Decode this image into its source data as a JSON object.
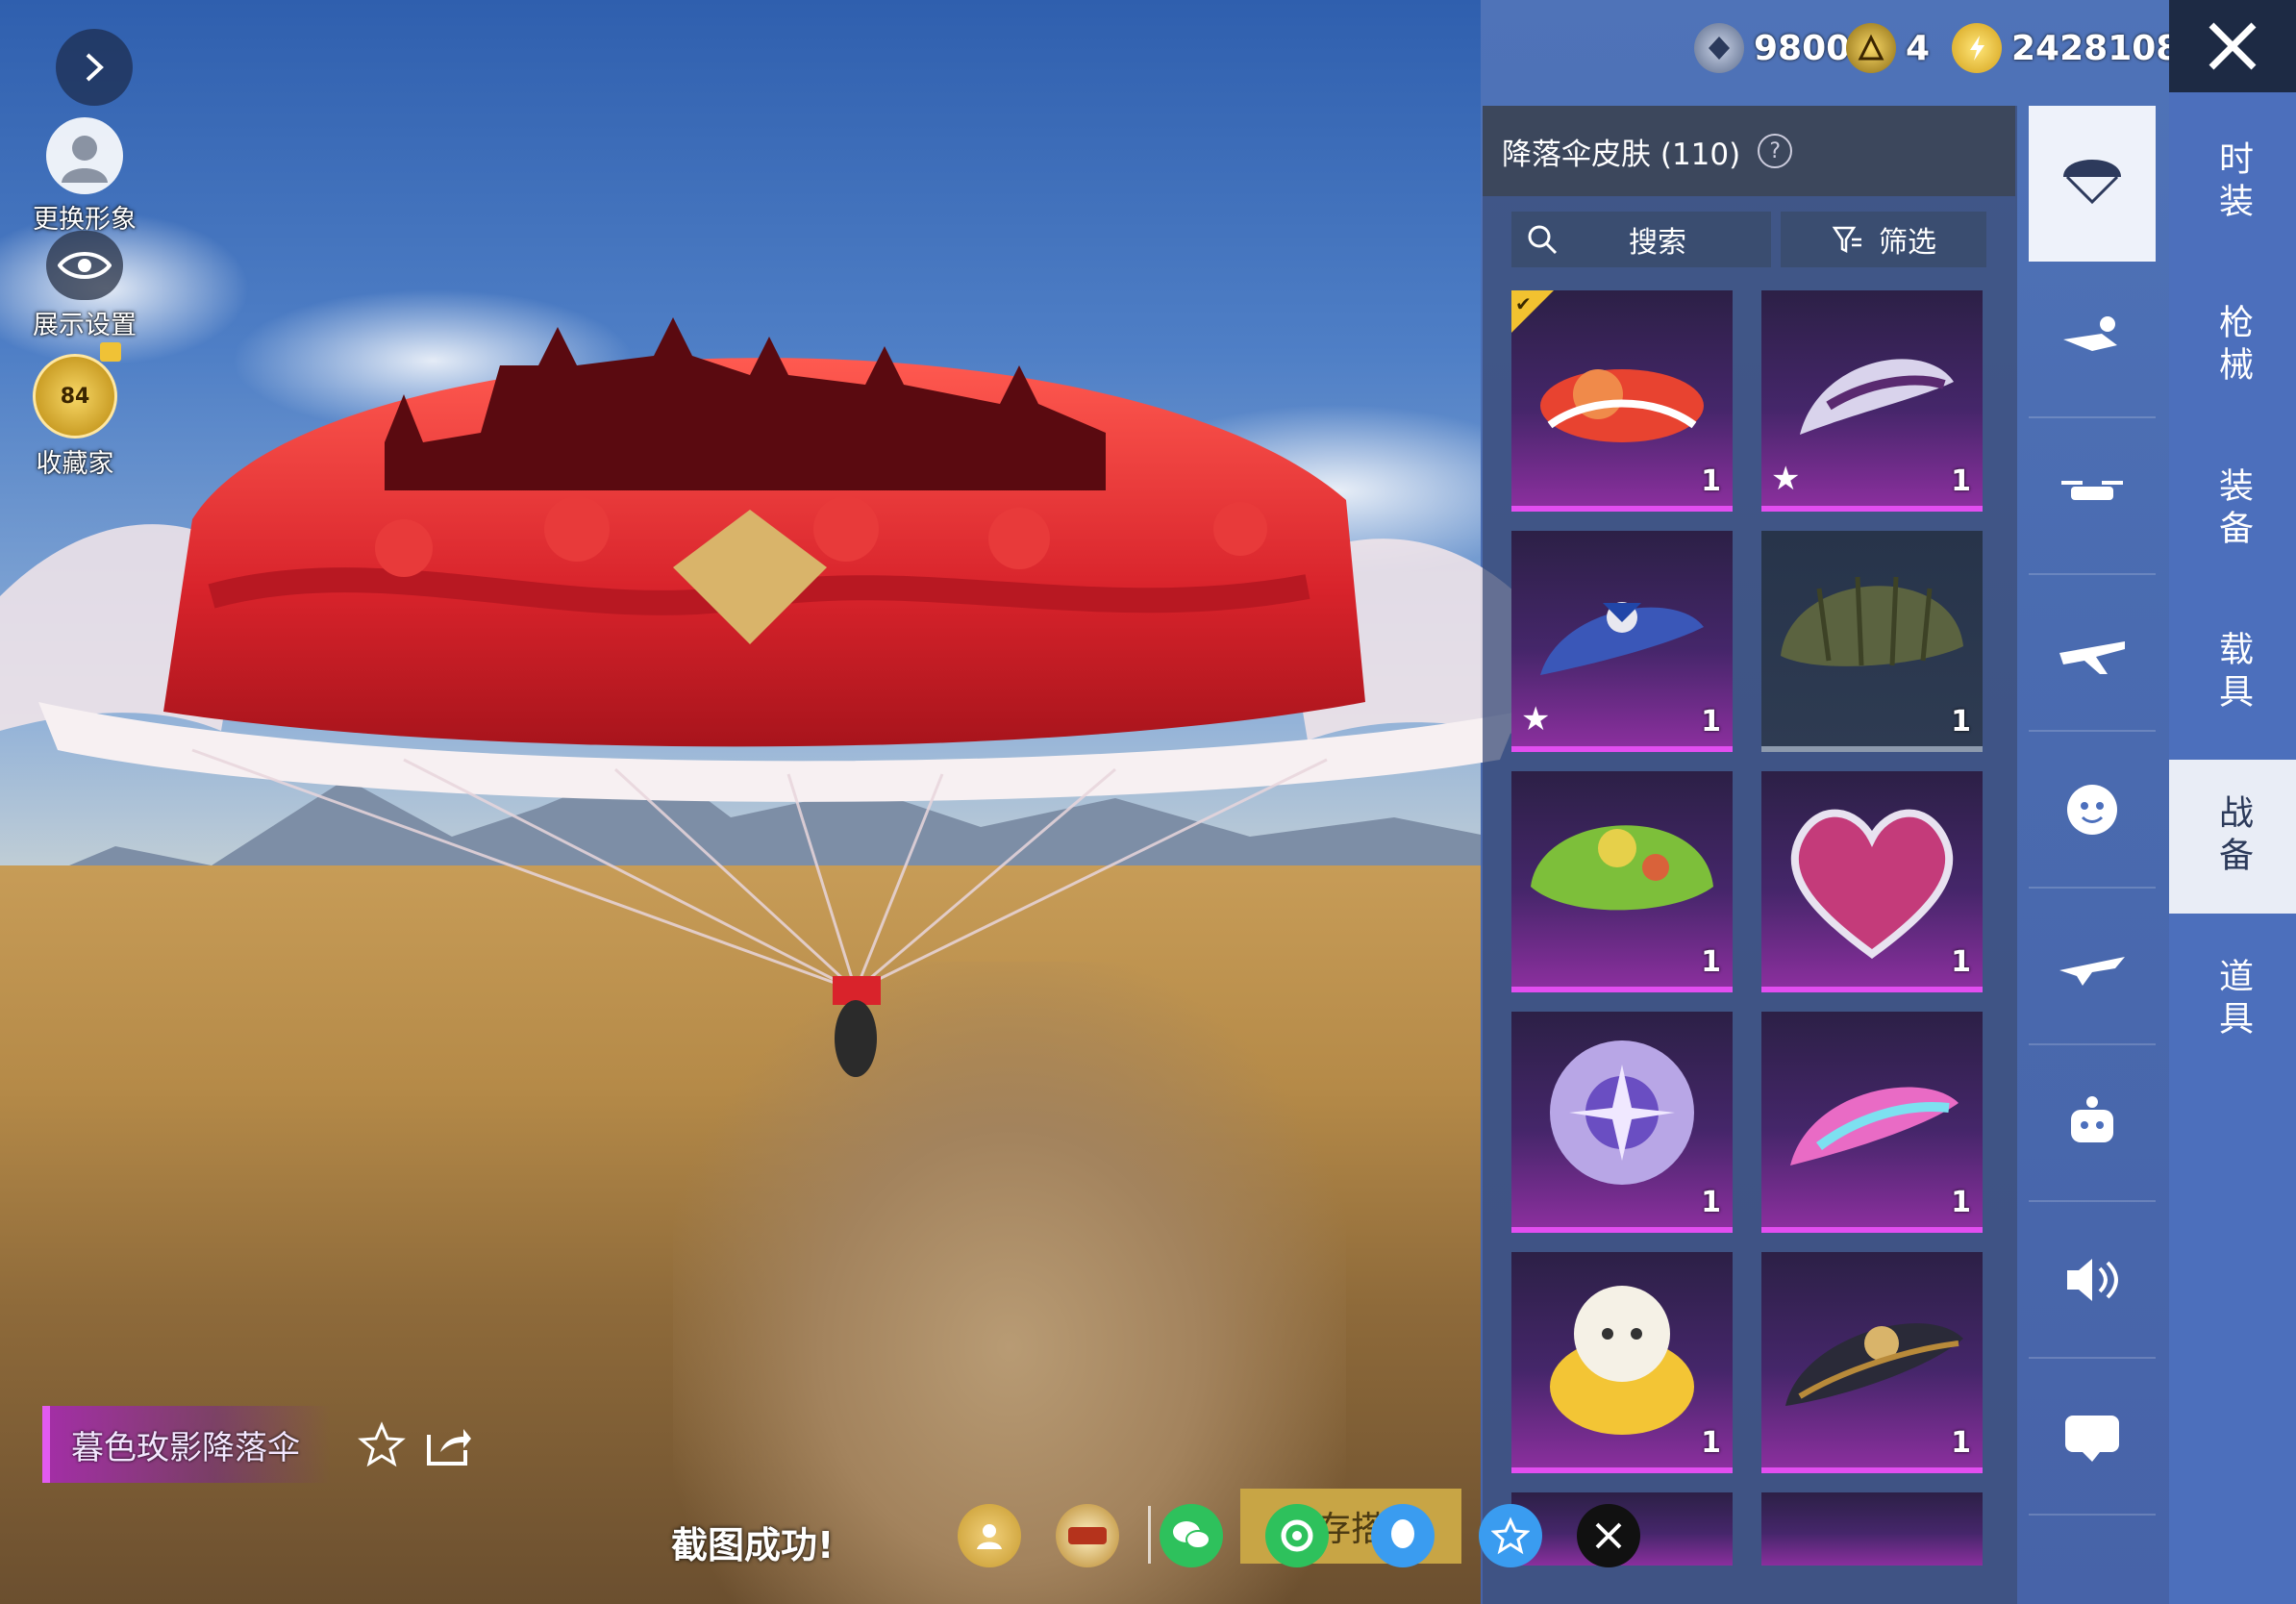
{
  "left_controls": {
    "change_avatar": "更换形象",
    "display_settings": "展示设置",
    "collector": "收藏家",
    "collector_level": "84"
  },
  "currency": [
    {
      "icon": "gem-coin-icon",
      "value": "9800"
    },
    {
      "icon": "gold-medal-icon",
      "value": "4"
    },
    {
      "icon": "lightning-coin-icon",
      "value": "2428108"
    }
  ],
  "panel": {
    "title": "降落伞皮肤 (110)",
    "help": "?",
    "search": "搜索",
    "filter": "筛选"
  },
  "items": [
    {
      "name": "red-castle-parachute",
      "qty": "1",
      "selected": true,
      "star": false,
      "rarity": "purple"
    },
    {
      "name": "purple-white-parachute",
      "qty": "1",
      "selected": false,
      "star": true,
      "rarity": "purple"
    },
    {
      "name": "blue-bow-parachute",
      "qty": "1",
      "selected": false,
      "star": true,
      "rarity": "purple"
    },
    {
      "name": "olive-basic-parachute",
      "qty": "1",
      "selected": false,
      "star": false,
      "rarity": "dark"
    },
    {
      "name": "green-cartoon-parachute",
      "qty": "1",
      "selected": false,
      "star": false,
      "rarity": "purple"
    },
    {
      "name": "heart-parachute",
      "qty": "1",
      "selected": false,
      "star": false,
      "rarity": "purple"
    },
    {
      "name": "crystal-parachute",
      "qty": "1",
      "selected": false,
      "star": false,
      "rarity": "purple"
    },
    {
      "name": "pink-neon-parachute",
      "qty": "1",
      "selected": false,
      "star": false,
      "rarity": "purple"
    },
    {
      "name": "sheep-parachute",
      "qty": "1",
      "selected": false,
      "star": false,
      "rarity": "purple"
    },
    {
      "name": "dark-gold-parachute",
      "qty": "1",
      "selected": false,
      "star": false,
      "rarity": "purple"
    }
  ],
  "icon_column": [
    "parachute-icon",
    "skydiver-icon",
    "drone-icon",
    "airplane-icon",
    "emote-face-icon",
    "glider-icon",
    "robot-icon",
    "speaker-icon",
    "chat-icon"
  ],
  "tabs": [
    "时装",
    "枪械",
    "装备",
    "载具",
    "战备",
    "道具"
  ],
  "active_tab": "战备",
  "bottom": {
    "item_name": "暮色玫影降落伞",
    "toast": "截图成功!",
    "save_label": "存搭"
  },
  "share_targets": [
    "profile-icon",
    "game-logo-icon",
    "wechat-icon",
    "moments-icon",
    "qq-icon",
    "qzone-icon",
    "x-icon"
  ],
  "colors": {
    "tab_bg": "#4c6fbc",
    "rarity_purple": "#e24ef0",
    "active_tab": "#e9edf6",
    "gold": "#f2c230"
  }
}
